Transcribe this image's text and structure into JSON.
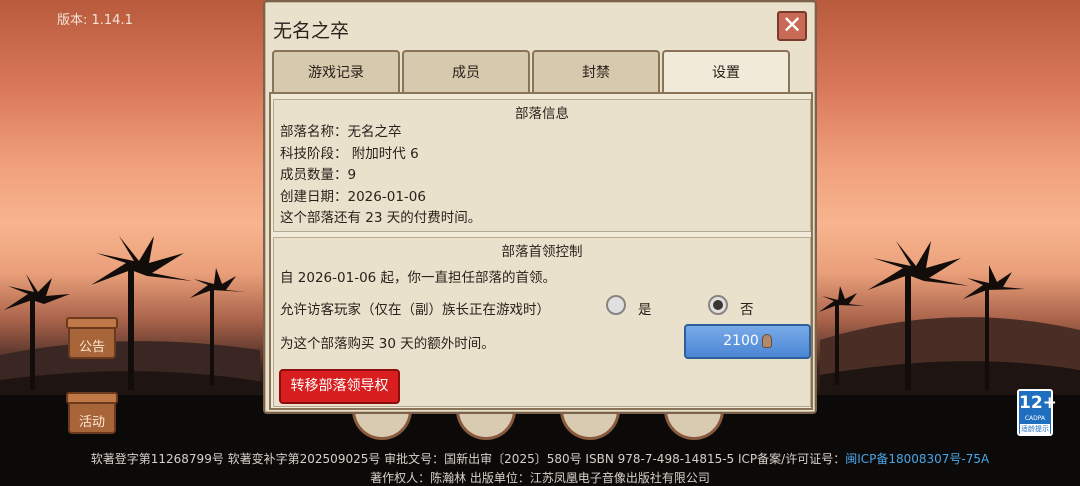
{
  "version": "版本: 1.14.1",
  "side_buttons": {
    "notice_label": "公告",
    "event_label": "活动"
  },
  "age_badge": {
    "num": "12+",
    "sub": "CADPA",
    "tip": "适龄提示"
  },
  "footer": {
    "line1": "软著登字第11268799号 软著变补字第202509025号 审批文号：国新出审〔2025〕580号 ISBN 978-7-498-14815-5 ICP备案/许可证号：",
    "icp_link": "闽ICP备18008307号-75A",
    "line2": "著作权人：陈瀚林 出版单位：江苏凤凰电子音像出版社有限公司"
  },
  "dialog": {
    "title": "无名之卒",
    "close_icon": "close-x-icon",
    "tabs": [
      "游戏记录",
      "成员",
      "封禁",
      "设置"
    ],
    "active_tab": 3,
    "tribe_info": {
      "title": "部落信息",
      "lines": [
        "部落名称：无名之卒",
        "科技阶段： 附加时代 6",
        "成员数量：9",
        "创建日期：2026-01-06",
        "这个部落还有 23 天的付费时间。"
      ]
    },
    "leader_control": {
      "title": "部落首领控制",
      "since_text": "自 2026-01-06 起，你一直担任部落的首领。",
      "guest_question": "允许访客玩家（仅在（副）族长正在游戏时）",
      "option_yes": "是",
      "option_no": "否",
      "selected": "否",
      "buy_text": "为这个部落购买 30 天的额外时间。",
      "buy_price": "2100",
      "transfer_label": "转移部落领导权"
    }
  },
  "colors": {
    "accent_blue": "#4a86d4",
    "danger_red": "#d81e1e",
    "panel": "#eae1cd"
  }
}
